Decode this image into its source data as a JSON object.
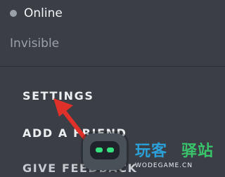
{
  "status_menu": {
    "online_label": "Online",
    "invisible_label": "Invisible"
  },
  "actions": {
    "settings_label": "SETTINGS",
    "add_friend_label": "ADD A FRIEND",
    "give_feedback_label": "GIVE FEEDBACK"
  },
  "watermark": {
    "brand_part1": "玩客",
    "brand_part2": "驿站",
    "url": "WODEGAME.CN"
  },
  "colors": {
    "background": "#3b3f45",
    "annotation_arrow": "#e0302a",
    "status_dot": "#9aa1a8",
    "watermark_blue": "#2b9fd8",
    "watermark_green": "#39c36b",
    "robot_eye": "#36e07f"
  }
}
